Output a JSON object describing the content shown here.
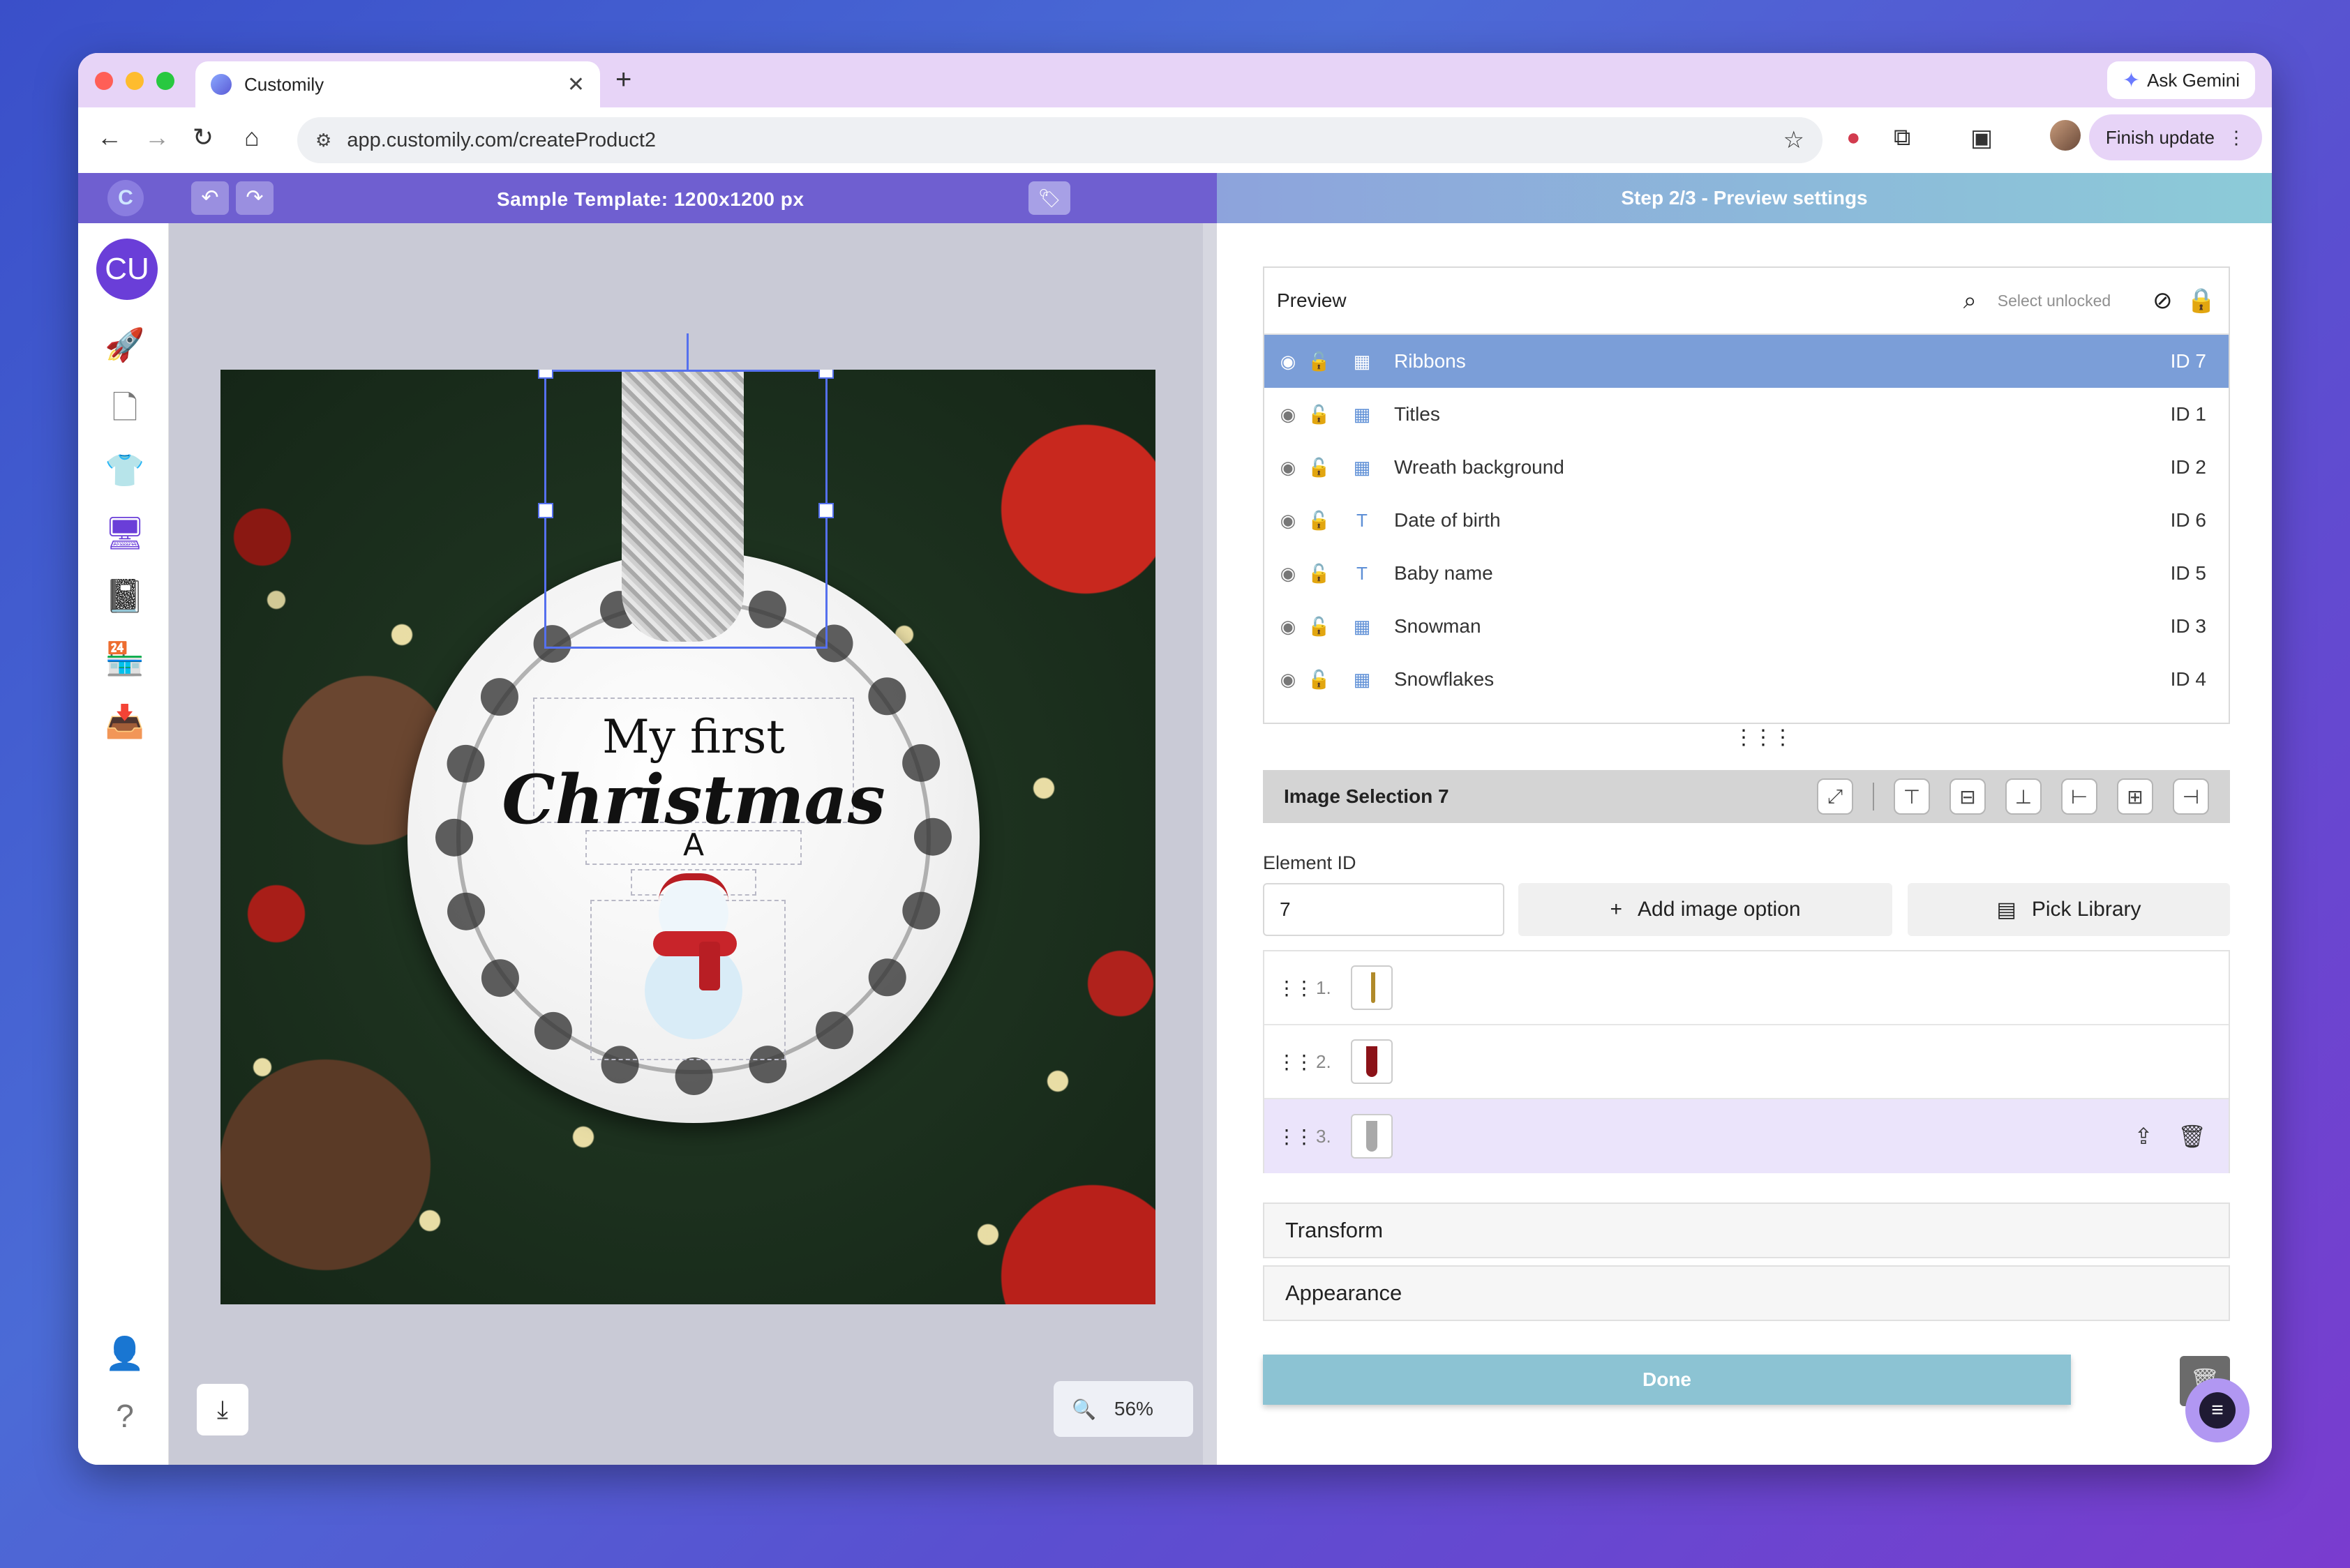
{
  "browser": {
    "tab_title": "Customily",
    "tab_close": "✕",
    "new_tab": "+",
    "gemini_label": "Ask Gemini",
    "url": "app.customily.com/createProduct2",
    "finish_update_label": "Finish update"
  },
  "app_header": {
    "template_title": "Sample Template: 1200x1200 px",
    "step_title": "Step 2/3 - Preview settings"
  },
  "rail": {
    "avatar_initials": "CU",
    "icons": [
      "rocket-icon",
      "document-icon",
      "tshirt-icon",
      "monitor-icon",
      "book-icon",
      "store-icon",
      "inbox-icon",
      "user-settings-icon",
      "help-icon",
      "logout-icon"
    ]
  },
  "canvas": {
    "ornament_line1": "My first",
    "ornament_line2": "Christmas",
    "ornament_initial_large": "A",
    "ornament_initial_small": "A",
    "zoom_level": "56%"
  },
  "preview": {
    "title": "Preview",
    "select_unlocked_label": "Select unlocked",
    "layers": [
      {
        "name": "Ribbons",
        "id": "ID 7",
        "type": "image",
        "selected": true
      },
      {
        "name": "Titles",
        "id": "ID 1",
        "type": "image",
        "selected": false
      },
      {
        "name": "Wreath background",
        "id": "ID 2",
        "type": "image",
        "selected": false
      },
      {
        "name": "Date of birth",
        "id": "ID 6",
        "type": "text",
        "selected": false
      },
      {
        "name": "Baby name",
        "id": "ID 5",
        "type": "text",
        "selected": false
      },
      {
        "name": "Snowman",
        "id": "ID 3",
        "type": "image",
        "selected": false
      },
      {
        "name": "Snowflakes",
        "id": "ID 4",
        "type": "image",
        "selected": false
      }
    ]
  },
  "image_selection": {
    "title": "Image Selection 7",
    "element_id_label": "Element ID",
    "element_id_value": "7",
    "add_image_option_label": "Add image option",
    "pick_library_label": "Pick Library",
    "options": [
      {
        "index": "1.",
        "thumb_color": "#b08a2a"
      },
      {
        "index": "2.",
        "thumb_color": "#8b1218"
      },
      {
        "index": "3.",
        "thumb_color": "#a9a9a9"
      }
    ]
  },
  "accordions": {
    "transform_label": "Transform",
    "appearance_label": "Appearance"
  },
  "done_label": "Done",
  "colors": {
    "header_purple": "#6f5fd0",
    "selected_row": "#7b9ed8",
    "done_button": "#8cc3d3",
    "highlight_option": "#ebe4fb"
  }
}
